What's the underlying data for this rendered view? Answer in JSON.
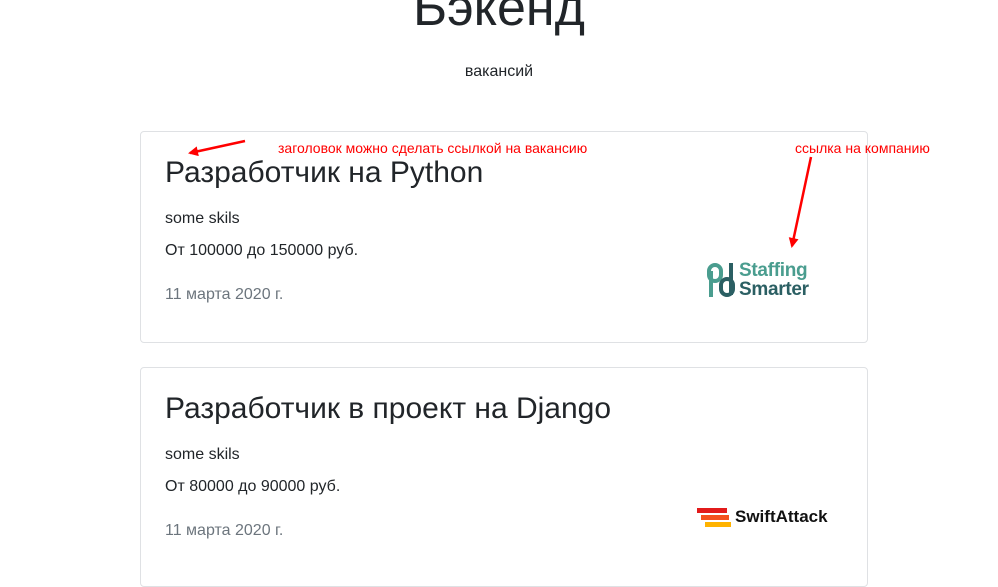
{
  "header": {
    "title": "Бэкенд",
    "subtitle": "вакансий"
  },
  "vacancies": [
    {
      "title": "Разработчик на Python",
      "skills": "some skils",
      "salary": "От 100000 до 150000 руб.",
      "date": "11 марта 2020 г.",
      "company_logo": {
        "line1": "Staffing",
        "line2": "Smarter",
        "icon": "pd-monogram-logo"
      }
    },
    {
      "title": "Разработчик в проект на Django",
      "skills": "some skils",
      "salary": "От 80000 до 90000 руб.",
      "date": "11 марта 2020 г.",
      "company_logo": {
        "text": "SwiftAttack",
        "icon": "speed-stripes-logo"
      }
    }
  ],
  "annotations": {
    "title_note": "заголовок можно сделать ссылкой на вакансию",
    "company_note": "ссылка на компанию",
    "color": "#ff0000"
  },
  "colors": {
    "text": "#212529",
    "muted": "#6c757d",
    "card_border": "#dfe1e4"
  }
}
